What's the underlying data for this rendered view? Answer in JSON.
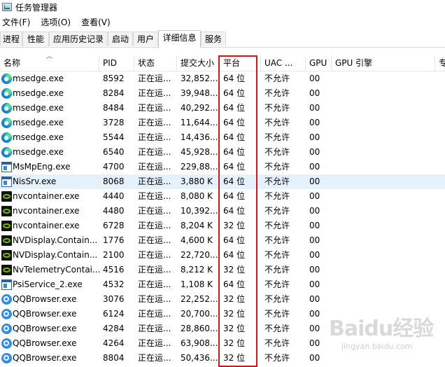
{
  "window": {
    "title": "任务管理器"
  },
  "menu": [
    "文件(F)",
    "选项(O)",
    "查看(V)"
  ],
  "tabs": [
    "进程",
    "性能",
    "应用历史记录",
    "启动",
    "用户",
    "详细信息",
    "服务"
  ],
  "active_tab": "详细信息",
  "columns": [
    "名称",
    "PID",
    "状态",
    "提交大小",
    "平台",
    "UAC ...",
    "GPU",
    "GPU 引擎",
    "专"
  ],
  "rows": [
    {
      "icon": "edge-icon",
      "name": "msedge.exe",
      "pid": "8592",
      "status": "正在运...",
      "commit": "32,852...",
      "platform": "64 位",
      "uac": "不允许",
      "gpu": "00"
    },
    {
      "icon": "edge-icon",
      "name": "msedge.exe",
      "pid": "8284",
      "status": "正在运...",
      "commit": "39,948...",
      "platform": "64 位",
      "uac": "不允许",
      "gpu": "00"
    },
    {
      "icon": "edge-icon",
      "name": "msedge.exe",
      "pid": "8484",
      "status": "正在运...",
      "commit": "40,292...",
      "platform": "64 位",
      "uac": "不允许",
      "gpu": "00"
    },
    {
      "icon": "edge-icon",
      "name": "msedge.exe",
      "pid": "3728",
      "status": "正在运...",
      "commit": "11,644...",
      "platform": "64 位",
      "uac": "不允许",
      "gpu": "00"
    },
    {
      "icon": "edge-icon",
      "name": "msedge.exe",
      "pid": "5544",
      "status": "正在运...",
      "commit": "14,436...",
      "platform": "64 位",
      "uac": "不允许",
      "gpu": "00"
    },
    {
      "icon": "edge-icon",
      "name": "msedge.exe",
      "pid": "6540",
      "status": "正在运...",
      "commit": "45,928...",
      "platform": "64 位",
      "uac": "不允许",
      "gpu": "00"
    },
    {
      "icon": "window-app-icon",
      "name": "MsMpEng.exe",
      "pid": "4700",
      "status": "正在运...",
      "commit": "229,88...",
      "platform": "64 位",
      "uac": "不允许",
      "gpu": "00"
    },
    {
      "icon": "window-app-icon",
      "name": "NisSrv.exe",
      "pid": "8068",
      "status": "正在运...",
      "commit": "3,880 K",
      "platform": "64 位",
      "uac": "不允许",
      "gpu": "00"
    },
    {
      "icon": "nvidia-icon",
      "name": "nvcontainer.exe",
      "pid": "4440",
      "status": "正在运...",
      "commit": "8,080 K",
      "platform": "64 位",
      "uac": "不允许",
      "gpu": "00"
    },
    {
      "icon": "nvidia-icon",
      "name": "nvcontainer.exe",
      "pid": "4480",
      "status": "正在运...",
      "commit": "10,392...",
      "platform": "64 位",
      "uac": "不允许",
      "gpu": "00"
    },
    {
      "icon": "nvidia-icon",
      "name": "nvcontainer.exe",
      "pid": "6728",
      "status": "正在运...",
      "commit": "8,204 K",
      "platform": "32 位",
      "uac": "不允许",
      "gpu": "00"
    },
    {
      "icon": "nvidia-icon",
      "name": "NVDisplay.Contain...",
      "pid": "1776",
      "status": "正在运...",
      "commit": "4,600 K",
      "platform": "64 位",
      "uac": "不允许",
      "gpu": "00"
    },
    {
      "icon": "nvidia-icon",
      "name": "NVDisplay.Contain...",
      "pid": "2100",
      "status": "正在运...",
      "commit": "22,720...",
      "platform": "64 位",
      "uac": "不允许",
      "gpu": "00"
    },
    {
      "icon": "nvidia-icon",
      "name": "NvTelemetryContai...",
      "pid": "4516",
      "status": "正在运...",
      "commit": "8,212 K",
      "platform": "32 位",
      "uac": "不允许",
      "gpu": "00"
    },
    {
      "icon": "window-app-icon",
      "name": "PsiService_2.exe",
      "pid": "4532",
      "status": "正在运...",
      "commit": "1,108 K",
      "platform": "64 位",
      "uac": "不允许",
      "gpu": "00"
    },
    {
      "icon": "qqbrowser-icon",
      "name": "QQBrowser.exe",
      "pid": "3076",
      "status": "正在运...",
      "commit": "22,252...",
      "platform": "32 位",
      "uac": "不允许",
      "gpu": "00"
    },
    {
      "icon": "qqbrowser-icon",
      "name": "QQBrowser.exe",
      "pid": "6124",
      "status": "正在运...",
      "commit": "20,700...",
      "platform": "32 位",
      "uac": "不允许",
      "gpu": "00"
    },
    {
      "icon": "qqbrowser-icon",
      "name": "QQBrowser.exe",
      "pid": "4284",
      "status": "正在运...",
      "commit": "28,860...",
      "platform": "32 位",
      "uac": "不允许",
      "gpu": "00"
    },
    {
      "icon": "qqbrowser-icon",
      "name": "QQBrowser.exe",
      "pid": "4264",
      "status": "正在运...",
      "commit": "63,908...",
      "platform": "32 位",
      "uac": "不允许",
      "gpu": "00"
    },
    {
      "icon": "qqbrowser-icon",
      "name": "QQBrowser.exe",
      "pid": "8804",
      "status": "正在运...",
      "commit": "50,436...",
      "platform": "32 位",
      "uac": "不允许",
      "gpu": "00"
    }
  ],
  "highlighted_row": 7,
  "watermark": {
    "logo": "Baidu经验",
    "sub": "jingyan.baidu.com"
  },
  "colors": {
    "highlight_bg": "#e5f1fb",
    "annotation_box": "#d01818"
  }
}
